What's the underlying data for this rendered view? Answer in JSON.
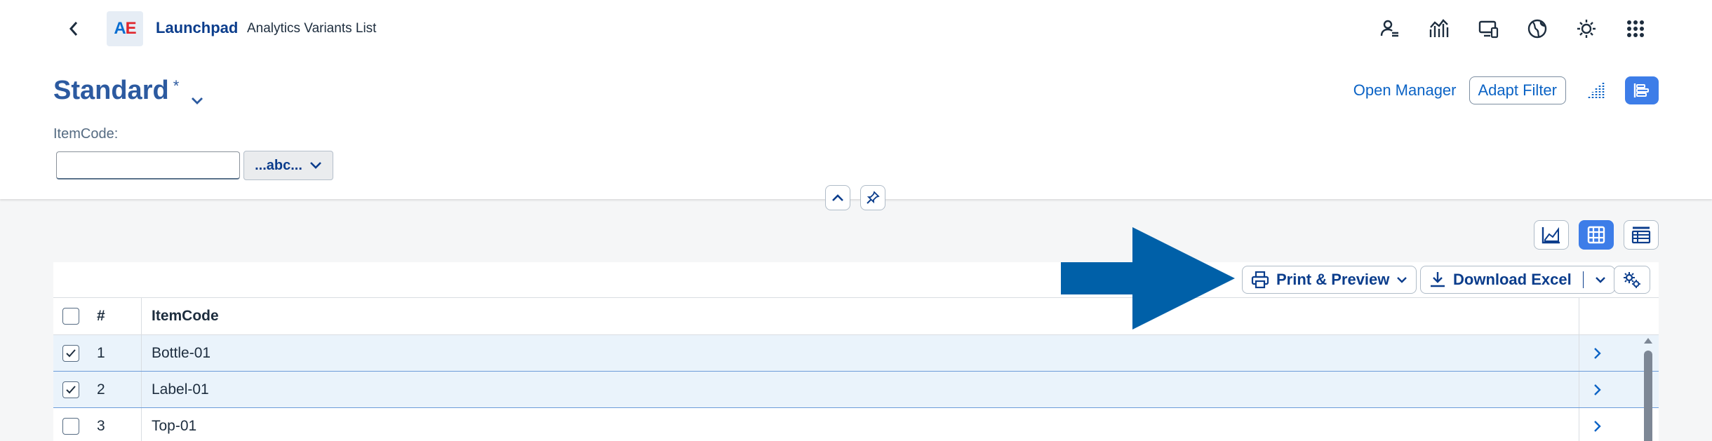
{
  "shell": {
    "logo_a": "A",
    "logo_e": "E",
    "app_title": "Launchpad",
    "page_subtitle": "Analytics Variants List",
    "icons": [
      "user-settings-icon",
      "analytics-icon",
      "devices-icon",
      "globe-icon",
      "theme-icon",
      "app-grid-icon"
    ]
  },
  "header": {
    "variant_name": "Standard",
    "variant_modified": "*",
    "filter_label": "ItemCode:",
    "filter_value": "",
    "filter_select": "...abc...",
    "open_manager": "Open Manager",
    "adapt_filter": "Adapt Filter"
  },
  "table": {
    "print_preview": "Print & Preview",
    "download_excel": "Download Excel",
    "columns": [
      "#",
      "ItemCode"
    ],
    "rows": [
      {
        "num": "1",
        "code": "Bottle-01",
        "selected": true
      },
      {
        "num": "2",
        "code": "Label-01",
        "selected": true
      },
      {
        "num": "3",
        "code": "Top-01",
        "selected": false
      }
    ]
  },
  "colors": {
    "accent": "#3d7de8",
    "link": "#0b63c5",
    "arrow": "#0060a8",
    "selected_row": "#eaf3fb"
  }
}
